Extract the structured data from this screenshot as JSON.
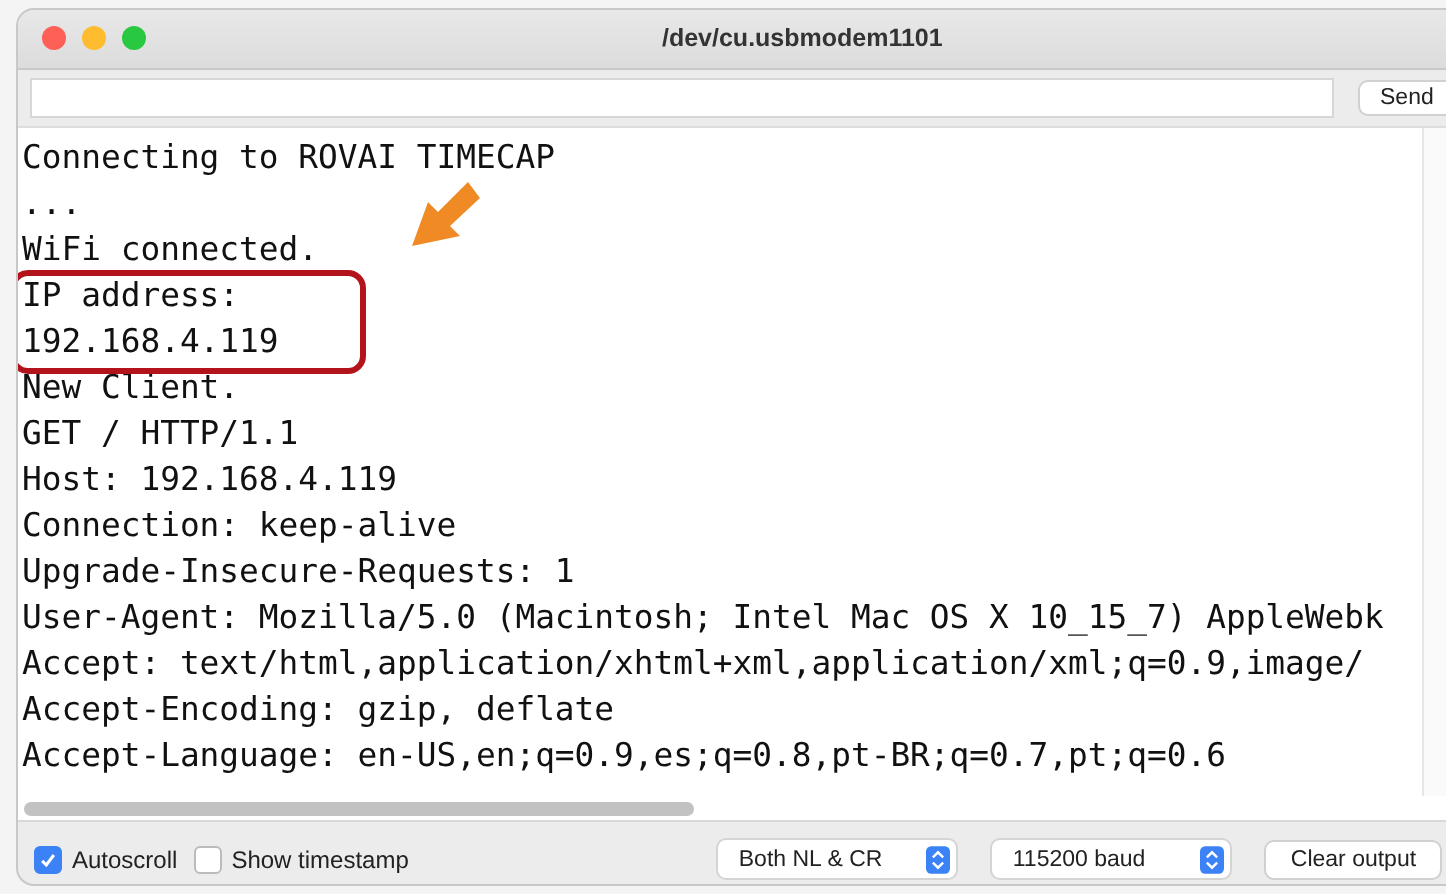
{
  "window": {
    "title": "/dev/cu.usbmodem1101"
  },
  "send_bar": {
    "button": "Send"
  },
  "output": {
    "lines": [
      "Connecting to ROVAI TIMECAP",
      "...",
      "WiFi connected.",
      "IP address:",
      "192.168.4.119",
      "New Client.",
      "GET / HTTP/1.1",
      "Host: 192.168.4.119",
      "Connection: keep-alive",
      "Upgrade-Insecure-Requests: 1",
      "User-Agent: Mozilla/5.0 (Macintosh; Intel Mac OS X 10_15_7) AppleWebk",
      "Accept: text/html,application/xhtml+xml,application/xml;q=0.9,image/",
      "Accept-Encoding: gzip, deflate",
      "Accept-Language: en-US,en;q=0.9,es;q=0.8,pt-BR;q=0.7,pt;q=0.6"
    ]
  },
  "footer": {
    "checkboxes": [
      {
        "label": "Autoscroll",
        "checked": true
      },
      {
        "label": "Show timestamp",
        "checked": false
      }
    ],
    "selects": [
      {
        "value": "Both NL & CR"
      },
      {
        "value": "115200 baud"
      }
    ],
    "button": "Clear output"
  }
}
